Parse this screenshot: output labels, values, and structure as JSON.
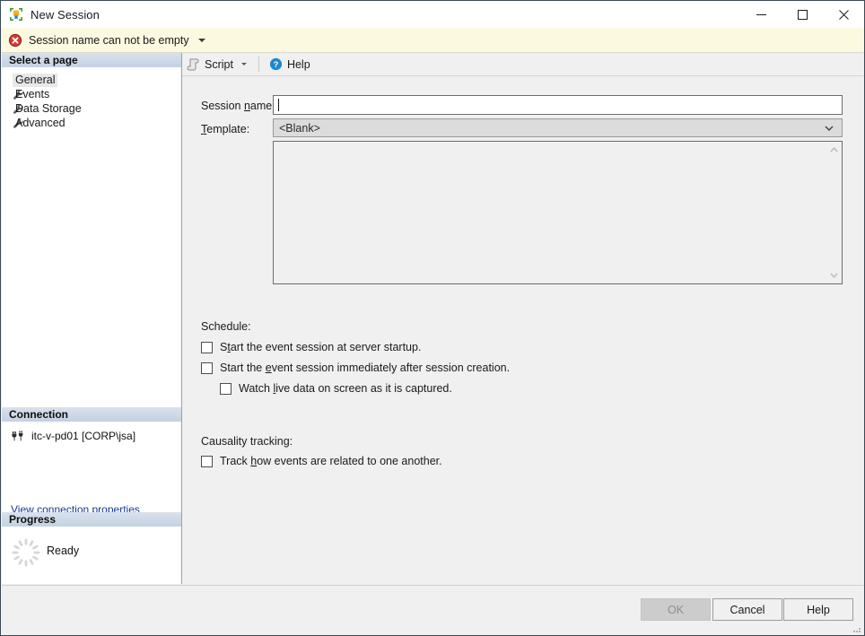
{
  "window": {
    "title": "New Session",
    "icon": "xevent-session-icon",
    "controls": {
      "minimize": "minimize-icon",
      "maximize": "maximize-icon",
      "close": "close-icon"
    }
  },
  "validation": {
    "icon": "error-icon",
    "message": "Session name can not be empty",
    "caret": "chevron-down-icon"
  },
  "sidebar": {
    "pages_header": "Select a page",
    "pages": [
      {
        "label": "General",
        "icon": "wrench-icon",
        "selected": true
      },
      {
        "label": "Events",
        "icon": "wrench-icon",
        "selected": false
      },
      {
        "label": "Data Storage",
        "icon": "wrench-icon",
        "selected": false
      },
      {
        "label": "Advanced",
        "icon": "wrench-icon",
        "selected": false
      }
    ],
    "connection_header": "Connection",
    "connection_name": "itc-v-pd01 [CORP\\jsa]",
    "connection_icon": "server-connection-icon",
    "connection_link": "View connection properties",
    "progress_header": "Progress",
    "progress_status": "Ready",
    "progress_icon": "spinner-icon"
  },
  "toolbar": {
    "script_label": "Script",
    "script_icon": "script-icon",
    "script_caret": "chevron-down-icon",
    "help_label": "Help",
    "help_icon": "help-question-icon"
  },
  "form": {
    "session_name_label": "Session name:",
    "session_name_value": "",
    "template_label": "Template:",
    "template_value": "<Blank>",
    "template_arrow": "chevron-down-icon",
    "description_value": "",
    "scroll_up": "scroll-up-arrow",
    "scroll_down": "scroll-down-arrow",
    "schedule_label": "Schedule:",
    "schedule_options": [
      {
        "label": "Start the event session at server startup.",
        "checked": false
      },
      {
        "label": "Start the event session immediately after session creation.",
        "checked": false
      },
      {
        "label": "Watch live data on screen as it is captured.",
        "checked": false,
        "indented": true
      }
    ],
    "causality_label": "Causality tracking:",
    "causality_options": [
      {
        "label": "Track how events are related to one another.",
        "checked": false
      }
    ]
  },
  "footer": {
    "ok_label": "OK",
    "ok_disabled": true,
    "cancel_label": "Cancel",
    "help_label": "Help",
    "resize_grip": "resize-grip-icon"
  },
  "colors": {
    "window_border": "#3b4b57",
    "error_bg": "#fbf9e0",
    "section_header": "#c3d2e3",
    "link": "#16389c",
    "content_bg": "#f0f0f0"
  }
}
